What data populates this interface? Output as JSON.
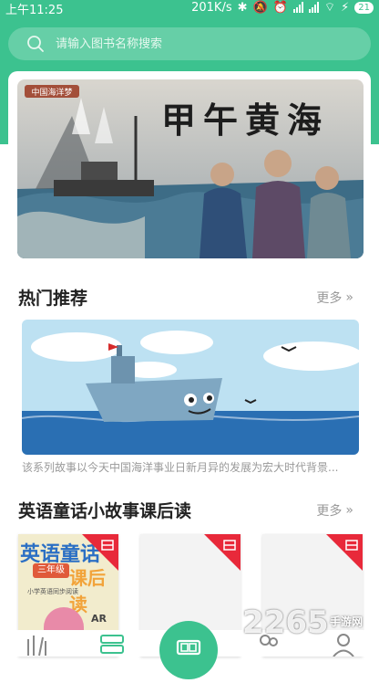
{
  "status_bar": {
    "time": "上午11:25",
    "speed": "201K/s",
    "battery": "21"
  },
  "search": {
    "placeholder": "请输入图书名称搜索"
  },
  "banner": {
    "series_label": "中国海洋梦",
    "title": "甲午黄海"
  },
  "hot_section": {
    "title": "热门推荐",
    "more": "更多",
    "description": "该系列故事以今天中国海洋事业日新月异的发展为宏大时代背景..."
  },
  "english_section": {
    "title": "英语童话小故事课后读",
    "more": "更多",
    "book1": {
      "title": "英语童话",
      "subtitle": "课后读",
      "grade": "三年级",
      "sub_small": "小学英语同步阅读",
      "badge": "AR"
    }
  },
  "watermark": {
    "text": "2265",
    "sub": "手游网"
  },
  "colors": {
    "accent": "#3cc28f",
    "badge": "#e8293a"
  }
}
